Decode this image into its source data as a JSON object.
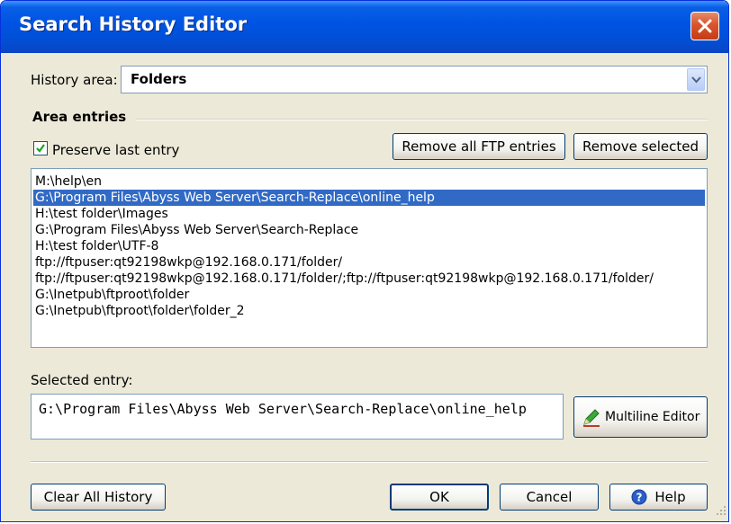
{
  "window": {
    "title": "Search History Editor"
  },
  "history_area": {
    "label": "History area:",
    "value": "Folders"
  },
  "area_entries": {
    "title": "Area entries",
    "preserve_label": "Preserve last entry",
    "preserve_checked": true,
    "remove_ftp_label": "Remove all FTP entries",
    "remove_selected_label": "Remove selected"
  },
  "entries": [
    "M:\\help\\en",
    "G:\\Program Files\\Abyss Web Server\\Search-Replace\\online_help",
    "H:\\test folder\\Images",
    "G:\\Program Files\\Abyss Web Server\\Search-Replace",
    "H:\\test folder\\UTF-8",
    "ftp://ftpuser:qt92198wkp@192.168.0.171/folder/",
    "ftp://ftpuser:qt92198wkp@192.168.0.171/folder/;ftp://ftpuser:qt92198wkp@192.168.0.171/folder/",
    "G:\\Inetpub\\ftproot\\folder",
    "G:\\Inetpub\\ftproot\\folder\\folder_2"
  ],
  "selected_index": 1,
  "selected_entry": {
    "label": "Selected entry:",
    "value": "G:\\Program Files\\Abyss Web Server\\Search-Replace\\online_help",
    "multiline_label": "Multiline Editor"
  },
  "footer": {
    "clear_label": "Clear All History",
    "ok_label": "OK",
    "cancel_label": "Cancel",
    "help_label": "Help"
  },
  "icons": {
    "close": "close-icon",
    "dropdown": "chevron-down-icon",
    "check": "checkmark-icon",
    "multiline": "pencil-icon",
    "help": "help-icon"
  },
  "colors": {
    "titlebar": "#0054e3",
    "selection": "#316ac5",
    "dialog_bg": "#ece9d8",
    "close_button": "#d9542d"
  }
}
